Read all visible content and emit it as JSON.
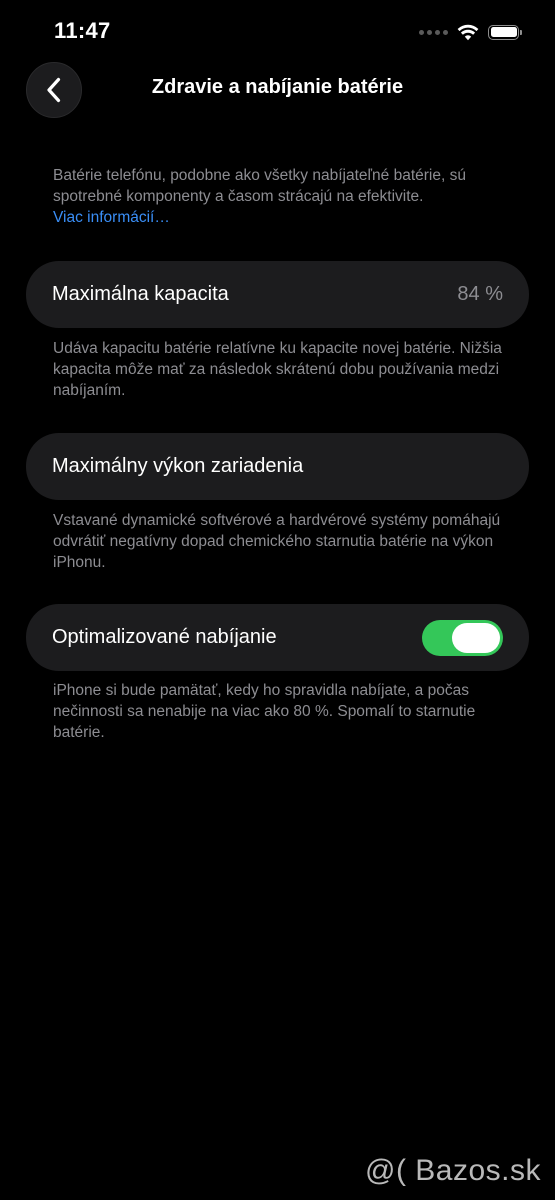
{
  "status_bar": {
    "time": "11:47",
    "icons": [
      "cellular-dots-icon",
      "wifi-icon",
      "battery-icon"
    ]
  },
  "nav": {
    "back_icon": "chevron-left-icon",
    "title": "Zdravie a nabíjanie batérie"
  },
  "intro": {
    "text": "Batérie telefónu, podobne ako všetky nabíjateľné batérie, sú spotrebné komponenty a časom strácajú na efektivite.",
    "link": "Viac informácií…"
  },
  "max_capacity": {
    "label": "Maximálna kapacita",
    "value": "84 %",
    "description": "Udáva kapacitu batérie relatívne ku kapacite novej batérie. Nižšia kapacita môže mať za následok skrátenú dobu používania medzi nabíjaním."
  },
  "peak_performance": {
    "label": "Maximálny výkon zariadenia",
    "description": "Vstavané dynamické softvérové a hardvérové systémy pomáhajú odvrátiť negatívny dopad chemického starnutia batérie na výkon iPhonu."
  },
  "optimized_charging": {
    "label": "Optimalizované nabíjanie",
    "enabled": true,
    "description": "iPhone si bude pamätať, kedy ho spravidla nabíjate, a počas nečinnosti sa nenabije na viac ako 80 %. Spomalí to starnutie batérie."
  },
  "colors": {
    "background": "#000000",
    "card": "#1c1c1e",
    "secondary_text": "#8d8d92",
    "link": "#3a8ef6",
    "toggle_on": "#34c759"
  },
  "watermark": "@( Bazos.sk"
}
